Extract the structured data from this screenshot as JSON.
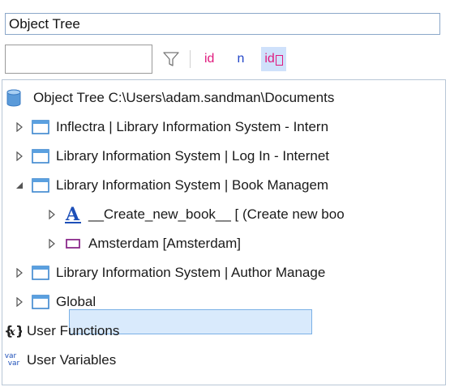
{
  "panel": {
    "title": "Object Tree"
  },
  "toolbar": {
    "filter_value": "",
    "filter_icon": "funnel-icon",
    "toggle_id": "id",
    "toggle_n": "n",
    "toggle_idb": "id"
  },
  "tree": {
    "root": {
      "label": "Object Tree C:\\Users\\adam.sandman\\Documents",
      "icon": "database-icon"
    },
    "items": [
      {
        "label": "Inflectra | Library Information System - Intern",
        "icon": "window-icon",
        "expanded": false
      },
      {
        "label": "Library Information System | Log In - Internet",
        "icon": "window-icon",
        "expanded": false
      },
      {
        "label": "Library Information System | Book Managem",
        "icon": "window-icon",
        "expanded": true
      },
      {
        "label": "__Create_new_book__ [ (Create new boo",
        "icon": "text-link-icon",
        "expanded": false
      },
      {
        "label": "Amsterdam [Amsterdam]",
        "icon": "element-icon",
        "expanded": false,
        "selected": true
      },
      {
        "label": "Library Information System | Author Manage",
        "icon": "window-icon",
        "expanded": false
      },
      {
        "label": "Global",
        "icon": "window-icon",
        "expanded": false
      }
    ],
    "functions": {
      "label": "User Functions",
      "icon": "function-icon"
    },
    "variables": {
      "label": "User Variables",
      "icon": "var-icon",
      "icon_text": "var"
    }
  },
  "colors": {
    "accent_pink": "#e0197d",
    "accent_blue": "#2346c8",
    "selection": "#d9eafc"
  }
}
